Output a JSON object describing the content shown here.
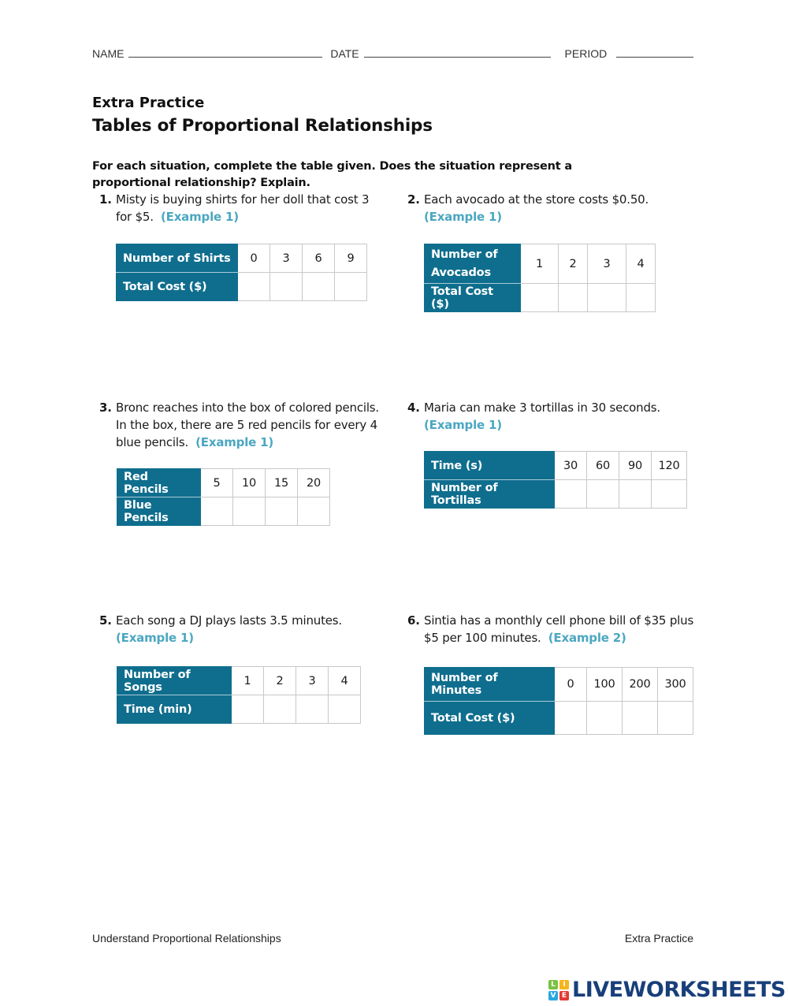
{
  "header": {
    "name_label": "NAME",
    "date_label": "DATE",
    "period_label": "PERIOD"
  },
  "subtitle": "Extra Practice",
  "title": "Tables of Proportional Relationships",
  "instructions": "For each situation, complete the table given. Does the situation represent a proportional relationship? Explain.",
  "problems": [
    {
      "number": "1.",
      "text": "Misty is buying shirts for her doll that cost 3 for $5.",
      "example": "(Example 1)",
      "table": {
        "row1_label": "Number of Shirts",
        "row1_values": [
          "0",
          "3",
          "6",
          "9"
        ],
        "row2_label": "Total Cost ($)",
        "row2_values": [
          "",
          "",
          "",
          ""
        ]
      }
    },
    {
      "number": "2.",
      "text": "Each avocado at the store costs $0.50.",
      "example": "(Example 1)",
      "table": {
        "row1_label": "Number of Avocados",
        "row1_values": [
          "1",
          "2",
          "3",
          "4"
        ],
        "row2_label": "Total Cost ($)",
        "row2_values": [
          "",
          "",
          "",
          ""
        ]
      }
    },
    {
      "number": "3.",
      "text": "Bronc reaches into the box of colored pencils. In the box, there are 5 red pencils for every 4 blue pencils.",
      "example": "(Example 1)",
      "table": {
        "row1_label": "Red Pencils",
        "row1_values": [
          "5",
          "10",
          "15",
          "20"
        ],
        "row2_label": "Blue Pencils",
        "row2_values": [
          "",
          "",
          "",
          ""
        ]
      }
    },
    {
      "number": "4.",
      "text": "Maria can make 3 tortillas in 30 seconds.",
      "example": "(Example 1)",
      "table": {
        "row1_label": "Time (s)",
        "row1_values": [
          "30",
          "60",
          "90",
          "120"
        ],
        "row2_label": "Number of Tortillas",
        "row2_values": [
          "",
          "",
          "",
          ""
        ]
      }
    },
    {
      "number": "5.",
      "text": "Each song a DJ plays lasts 3.5 minutes.",
      "example": "(Example 1)",
      "table": {
        "row1_label": "Number of Songs",
        "row1_values": [
          "1",
          "2",
          "3",
          "4"
        ],
        "row2_label": "Time (min)",
        "row2_values": [
          "",
          "",
          "",
          ""
        ]
      }
    },
    {
      "number": "6.",
      "text": "Sintia has a monthly cell phone bill of $35 plus $5 per 100 minutes.",
      "example": "(Example 2)",
      "table": {
        "row1_label": "Number of Minutes",
        "row1_values": [
          "0",
          "100",
          "200",
          "300"
        ],
        "row2_label": "Total Cost ($)",
        "row2_values": [
          "",
          "",
          "",
          ""
        ]
      }
    }
  ],
  "footer": {
    "left": "Understand Proportional Relationships",
    "right": "Extra Practice"
  },
  "watermark": {
    "grid": [
      "L",
      "I",
      "V",
      "E"
    ],
    "text": "LIVEWORKSHEETS"
  },
  "colors": {
    "table_header": "#0f6e8e",
    "example_link": "#4ba7c1",
    "logo_text": "#183f7a"
  }
}
